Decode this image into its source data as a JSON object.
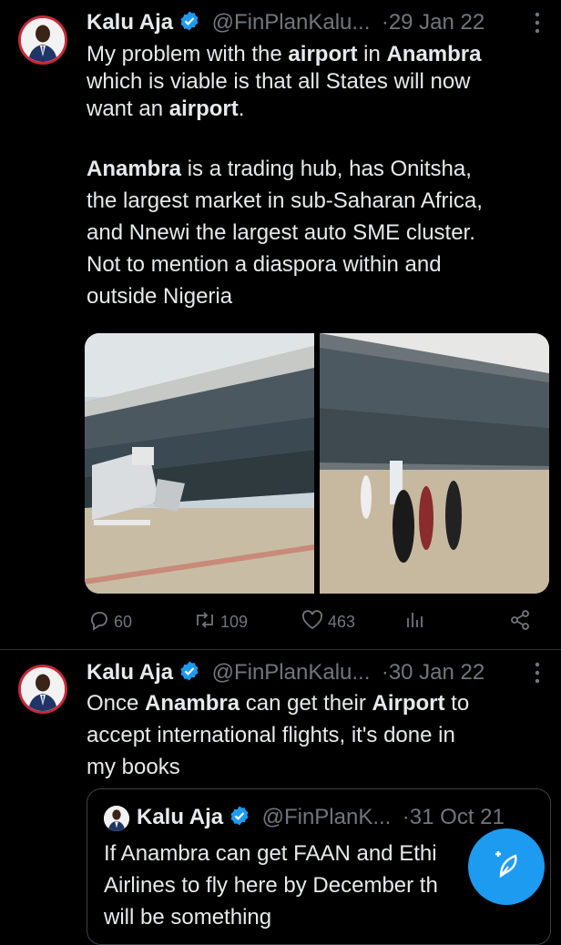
{
  "tweets": [
    {
      "author": "Kalu Aja",
      "handle": "@FinPlanKalu...",
      "date": "·29 Jan 22",
      "text_parts": [
        [
          "My problem with the ",
          false
        ],
        [
          "airport",
          true
        ],
        [
          " in ",
          false
        ],
        [
          "Anambra",
          true
        ],
        [
          "which is viable is that all States will now",
          false
        ],
        [
          "want an ",
          false
        ],
        [
          "airport",
          true
        ],
        [
          ".",
          false
        ],
        [
          "Anambra",
          true
        ],
        [
          " is a trading hub, has Onitsha,",
          false
        ],
        [
          "the largest market in sub-Saharan Africa,",
          false
        ],
        [
          "and Nnewi the largest auto SME cluster.",
          false
        ],
        [
          "Not to mention a diaspora within and",
          false
        ],
        [
          "outside Nigeria",
          false
        ]
      ],
      "lines": [
        "My problem with the airport in Anambra",
        "which is viable is that all States will now",
        "want an airport.",
        "",
        "Anambra is a trading hub, has Onitsha,",
        "the largest market in sub-Saharan Africa,",
        "and Nnewi the largest auto SME cluster.",
        "Not to mention a diaspora within and",
        "outside Nigeria"
      ],
      "replies": "60",
      "retweets": "109",
      "likes": "463"
    },
    {
      "author": "Kalu Aja",
      "handle": "@FinPlanKalu...",
      "date": "·30 Jan 22",
      "lines": [
        "Once Anambra can get their Airport to",
        "accept international flights, it's done in",
        "my books"
      ]
    }
  ],
  "quote": {
    "author": "Kalu Aja",
    "handle": "@FinPlanK...",
    "date": "·31 Oct 21",
    "lines": [
      "If Anambra can get FAAN and Ethi",
      "Airlines to fly here by December th",
      "will be something"
    ]
  },
  "icons": {
    "verified": "verified-badge-icon",
    "more": "more-vertical-icon",
    "reply": "reply-icon",
    "retweet": "retweet-icon",
    "like": "heart-icon",
    "views": "views-icon",
    "share": "share-icon",
    "compose": "compose-icon"
  },
  "colors": {
    "accent": "#1d9bf0",
    "muted": "#71767b",
    "text": "#e7e9ea"
  }
}
